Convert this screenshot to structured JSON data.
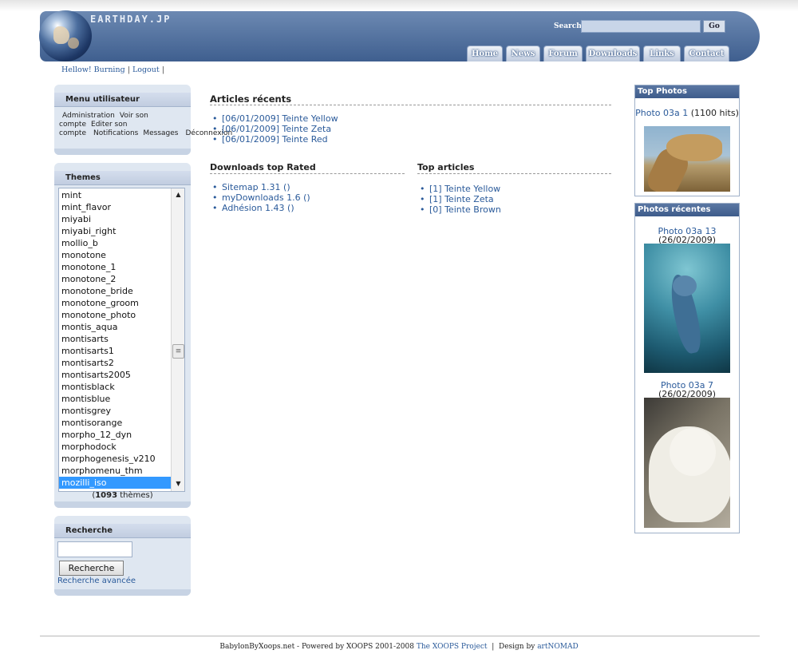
{
  "header": {
    "site_title": "EARTHDAY.JP",
    "search_label": "Search:",
    "search_value": "",
    "go_label": "Go",
    "nav": [
      "Home",
      "News",
      "Forum",
      "Downloads",
      "Links",
      "Contact"
    ]
  },
  "userbar": {
    "hello": "Hellow! Burning",
    "logout": "Logout"
  },
  "user_menu": {
    "title": "Menu utilisateur",
    "items": [
      "Administration",
      "Voir son compte",
      "Editer son compte",
      "Notifications",
      "Messages",
      "Déconnexion"
    ]
  },
  "themes": {
    "title": "Themes",
    "items": [
      "mint",
      "mint_flavor",
      "miyabi",
      "miyabi_right",
      "mollio_b",
      "monotone",
      "monotone_1",
      "monotone_2",
      "monotone_bride",
      "monotone_groom",
      "monotone_photo",
      "montis_aqua",
      "montisarts",
      "montisarts1",
      "montisarts2",
      "montisarts2005",
      "montisblack",
      "montisblue",
      "montisgrey",
      "montisorange",
      "morpho_12_dyn",
      "morphodock",
      "morphogenesis_v210",
      "morphomenu_thm",
      "mozilli_iso"
    ],
    "selected": "mozilli_iso",
    "count": "1093",
    "count_suffix": "thèmes"
  },
  "search_block": {
    "title": "Recherche",
    "input_value": "",
    "button": "Recherche",
    "advanced": "Recherche avancée"
  },
  "main": {
    "recent_articles": {
      "title": "Articles récents",
      "items": [
        "[06/01/2009] Teinte Yellow",
        "[06/01/2009] Teinte Zeta",
        "[06/01/2009] Teinte Red"
      ]
    },
    "downloads_top": {
      "title": "Downloads top Rated",
      "items": [
        "Sitemap 1.31 ()",
        "myDownloads 1.6 ()",
        "Adhésion 1.43 ()"
      ]
    },
    "top_articles": {
      "title": "Top articles",
      "items": [
        "[1] Teinte Yellow",
        "[1] Teinte Zeta",
        "[0] Teinte Brown"
      ]
    }
  },
  "right": {
    "top_photos": {
      "title": "Top Photos",
      "photo_link": "Photo 03a 1",
      "photo_meta": "(1100 hits)"
    },
    "recent_photos": {
      "title": "Photos récentes",
      "photos": [
        {
          "link": "Photo 03a 13",
          "meta": "(26/02/2009)"
        },
        {
          "link": "Photo 03a 7",
          "meta": "(26/02/2009)"
        }
      ]
    }
  },
  "footer": {
    "text": "BabylonByXoops.net - Powered by XOOPS 2001-2008",
    "xoops_link": "The XOOPS Project",
    "sep": "|",
    "design": "Design by",
    "designer": "artNOMAD"
  }
}
